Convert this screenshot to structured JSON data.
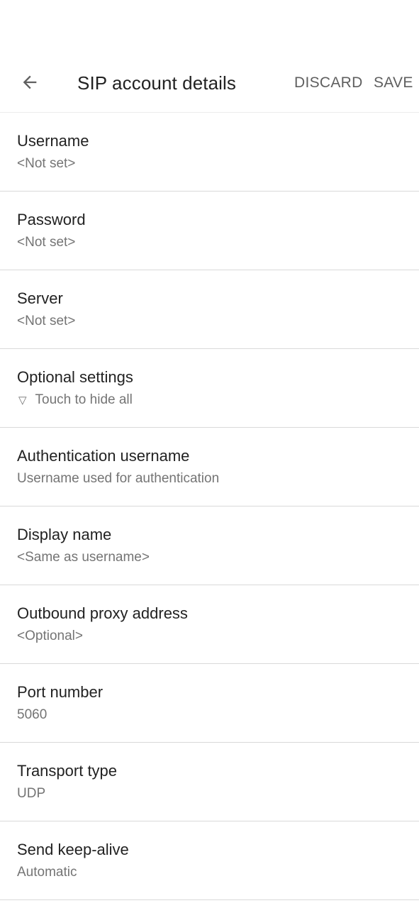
{
  "header": {
    "title": "SIP account details",
    "back_icon": "arrow-left-icon",
    "discard_label": "DISCARD",
    "save_label": "SAVE"
  },
  "items": [
    {
      "title": "Username",
      "subtitle": "<Not set>"
    },
    {
      "title": "Password",
      "subtitle": "<Not set>"
    },
    {
      "title": "Server",
      "subtitle": "<Not set>"
    },
    {
      "title": "Optional settings",
      "subtitle": "Touch to hide all",
      "icon": "triangle-down-outline-icon",
      "icon_glyph": "▽"
    },
    {
      "title": "Authentication username",
      "subtitle": "Username used for authentication"
    },
    {
      "title": "Display name",
      "subtitle": "<Same as username>"
    },
    {
      "title": "Outbound proxy address",
      "subtitle": "<Optional>"
    },
    {
      "title": "Port number",
      "subtitle": "5060"
    },
    {
      "title": "Transport type",
      "subtitle": "UDP"
    },
    {
      "title": "Send keep-alive",
      "subtitle": "Automatic"
    }
  ]
}
